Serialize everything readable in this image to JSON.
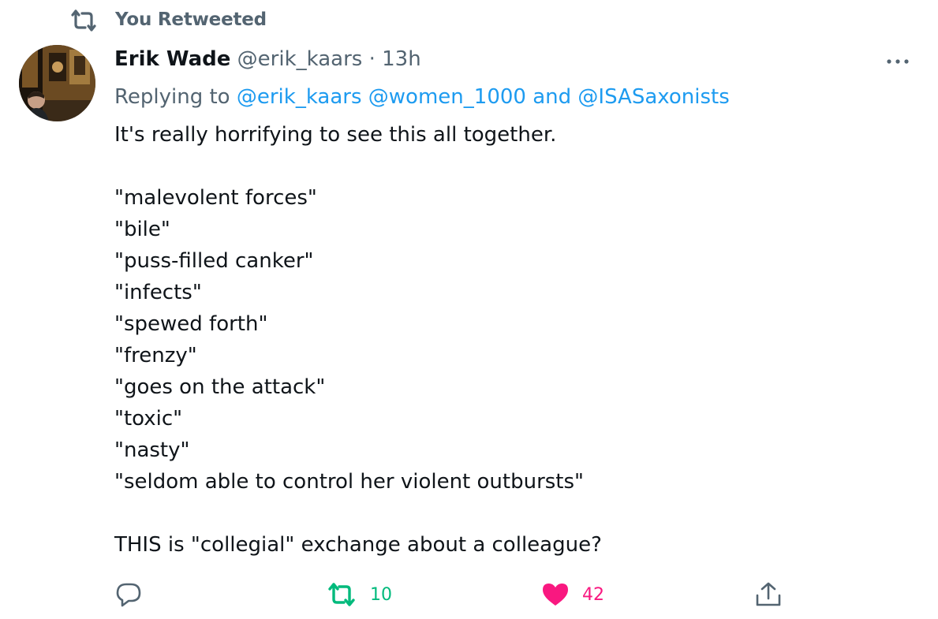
{
  "context": {
    "retweet_label": "You Retweeted"
  },
  "author": {
    "name": "Erik Wade",
    "handle": "@erik_kaars",
    "separator": "·",
    "time": "13h"
  },
  "replying": {
    "prefix": "Replying to",
    "mentions": [
      "@erik_kaars",
      "@women_1000"
    ],
    "conjunction": "and",
    "last_mention": "@ISASaxonists"
  },
  "tweet_lines": [
    "It's really horrifying to see this all together.",
    "",
    "\"malevolent forces\"",
    "\"bile\"",
    "\"puss-filled canker\"",
    "\"infects\"",
    "\"spewed forth\"",
    "\"frenzy\"",
    "\"goes on the attack\"",
    "\"toxic\"",
    "\"nasty\"",
    "\"seldom able to control her violent outbursts\"",
    "",
    "THIS is \"collegial\" exchange about a colleague?"
  ],
  "actions": {
    "reply_icon": "reply-icon",
    "retweet_icon": "retweet-icon",
    "retweet_count": "10",
    "like_icon": "heart-icon",
    "like_count": "42",
    "share_icon": "share-icon"
  },
  "colors": {
    "text": "#0f1419",
    "secondary": "#536471",
    "link": "#1d9bf0",
    "retweet_active": "#00ba7c",
    "like_active": "#f91880"
  }
}
